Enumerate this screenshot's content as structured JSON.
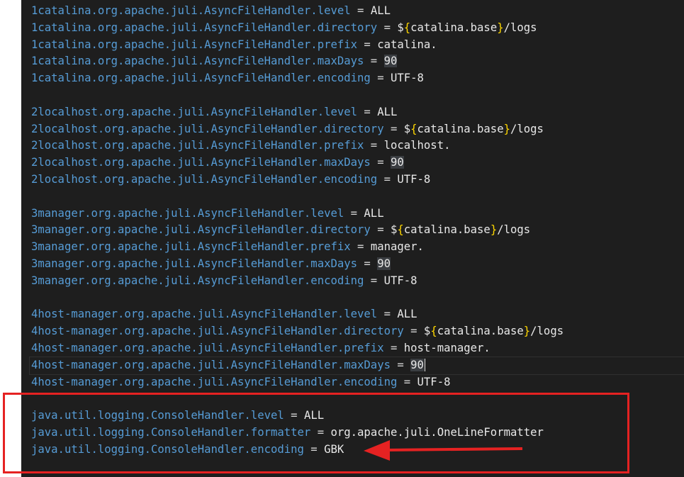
{
  "editor": {
    "lines": [
      {
        "key": "1catalina.org.apache.juli.AsyncFileHandler.level",
        "sep": " = ",
        "value": "ALL"
      },
      {
        "key": "1catalina.org.apache.juli.AsyncFileHandler.directory",
        "sep": " = ",
        "pre": "$",
        "brace_open": "{",
        "inner": "catalina.base",
        "brace_close": "}",
        "post": "/logs"
      },
      {
        "key": "1catalina.org.apache.juli.AsyncFileHandler.prefix",
        "sep": " = ",
        "value": "catalina."
      },
      {
        "key": "1catalina.org.apache.juli.AsyncFileHandler.maxDays",
        "sep": " = ",
        "num": "90"
      },
      {
        "key": "1catalina.org.apache.juli.AsyncFileHandler.encoding",
        "sep": " = ",
        "value": "UTF-8"
      },
      {},
      {
        "key": "2localhost.org.apache.juli.AsyncFileHandler.level",
        "sep": " = ",
        "value": "ALL"
      },
      {
        "key": "2localhost.org.apache.juli.AsyncFileHandler.directory",
        "sep": " = ",
        "pre": "$",
        "brace_open": "{",
        "inner": "catalina.base",
        "brace_close": "}",
        "post": "/logs"
      },
      {
        "key": "2localhost.org.apache.juli.AsyncFileHandler.prefix",
        "sep": " = ",
        "value": "localhost."
      },
      {
        "key": "2localhost.org.apache.juli.AsyncFileHandler.maxDays",
        "sep": " = ",
        "num": "90"
      },
      {
        "key": "2localhost.org.apache.juli.AsyncFileHandler.encoding",
        "sep": " = ",
        "value": "UTF-8"
      },
      {},
      {
        "key": "3manager.org.apache.juli.AsyncFileHandler.level",
        "sep": " = ",
        "value": "ALL"
      },
      {
        "key": "3manager.org.apache.juli.AsyncFileHandler.directory",
        "sep": " = ",
        "pre": "$",
        "brace_open": "{",
        "inner": "catalina.base",
        "brace_close": "}",
        "post": "/logs"
      },
      {
        "key": "3manager.org.apache.juli.AsyncFileHandler.prefix",
        "sep": " = ",
        "value": "manager."
      },
      {
        "key": "3manager.org.apache.juli.AsyncFileHandler.maxDays",
        "sep": " = ",
        "num": "90"
      },
      {
        "key": "3manager.org.apache.juli.AsyncFileHandler.encoding",
        "sep": " = ",
        "value": "UTF-8"
      },
      {},
      {
        "key": "4host-manager.org.apache.juli.AsyncFileHandler.level",
        "sep": " = ",
        "value": "ALL"
      },
      {
        "key": "4host-manager.org.apache.juli.AsyncFileHandler.directory",
        "sep": " = ",
        "pre": "$",
        "brace_open": "{",
        "inner": "catalina.base",
        "brace_close": "}",
        "post": "/logs"
      },
      {
        "key": "4host-manager.org.apache.juli.AsyncFileHandler.prefix",
        "sep": " = ",
        "value": "host-manager."
      },
      {
        "key": "4host-manager.org.apache.juli.AsyncFileHandler.maxDays",
        "sep": " = ",
        "num": "90",
        "cursor": true
      },
      {
        "key": "4host-manager.org.apache.juli.AsyncFileHandler.encoding",
        "sep": " = ",
        "value": "UTF-8"
      },
      {},
      {
        "key": "java.util.logging.ConsoleHandler.level",
        "sep": " = ",
        "value": "ALL"
      },
      {
        "key": "java.util.logging.ConsoleHandler.formatter",
        "sep": " = ",
        "value": "org.apache.juli.OneLineFormatter"
      },
      {
        "key": "java.util.logging.ConsoleHandler.encoding",
        "sep": " = ",
        "value": "GBK"
      }
    ]
  },
  "annotation": {
    "box_color": "#e52222",
    "arrow_color": "#e52222",
    "arrow_icon": "arrow-left-icon"
  },
  "colors": {
    "key": "#569cd6",
    "value": "#e8e8e8",
    "brace": "#ffd700",
    "background": "#1e1e1e"
  }
}
